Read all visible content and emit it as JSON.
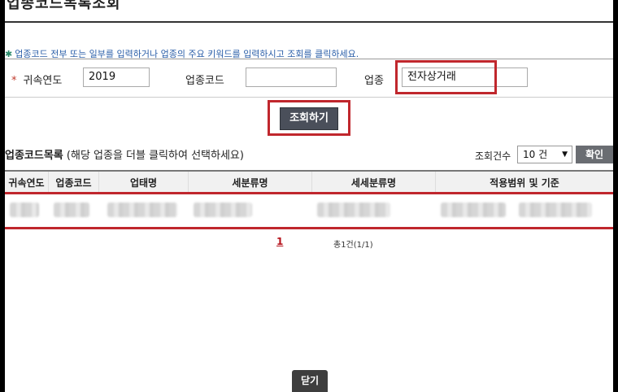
{
  "title": "업종코드목록조회",
  "guide_text": "업종코드 전부 또는 일부를 입력하거나 업종의 주요 키워드를 입력하시고 조회를 클릭하세요.",
  "search": {
    "year_label": "귀속연도",
    "year_value": "2019",
    "code_label": "업종코드",
    "code_value": "",
    "industry_label": "업종",
    "industry_value": "전자상거래",
    "search_button": "조회하기"
  },
  "list": {
    "title": "업종코드목록",
    "hint": "(해당 업종을 더블 클릭하여 선택하세요)",
    "count_label": "조회건수",
    "count_value": "10 건",
    "confirm_button": "확인",
    "columns": [
      "귀속연도",
      "업종코드",
      "업태명",
      "세분류명",
      "세세분류명",
      "적용범위 및 기준"
    ]
  },
  "pagination": {
    "current_page": "1",
    "total_text": "총1건(1/1)"
  },
  "close_button": "닫기",
  "colors": {
    "highlight": "#c0272d",
    "guide_text": "#2a5ea8",
    "button_dark": "#4a4f5a"
  }
}
